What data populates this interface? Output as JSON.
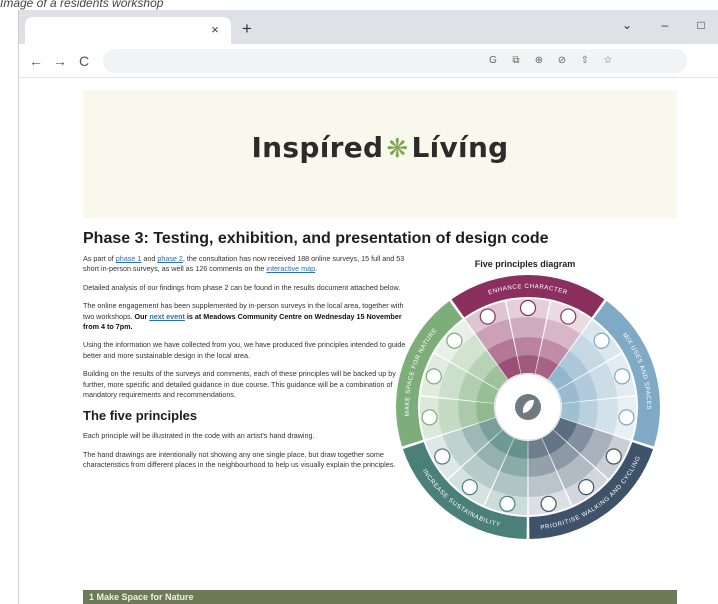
{
  "caption": "Image of a residents workshop",
  "browser": {
    "tab_close": "×",
    "new_tab": "+",
    "controls": {
      "menu": "⌄",
      "minimize": "–",
      "maximize": "□"
    },
    "nav": {
      "back": "←",
      "forward": "→",
      "reload": "C"
    },
    "omnibox_icons": [
      "G",
      "⧉",
      "⊕",
      "⊘",
      "⇧",
      "☆"
    ]
  },
  "hero": {
    "logo_left": "Inspíred",
    "logo_mark": "❋",
    "logo_right": "Lívíng"
  },
  "page": {
    "title": "Phase 3: Testing, exhibition, and presentation of design code",
    "p1": {
      "a": "As part of ",
      "link1": "phase 1",
      "b": " and ",
      "link2": "phase 2",
      "c": ", the consultation has now received 188 online surveys, 15 full and 53 short in-person surveys, as well as 126 comments on the ",
      "link3": "interactive map",
      "d": "."
    },
    "p2": "Detailed analysis of our findings from phase 2 can be found in the results document attached below.",
    "p3": {
      "a": "The online engagement has been supplemented by in-person surveys in the local area, together with two workshops. ",
      "b1": "Our ",
      "link": "next event",
      "b2": " is at Meadows Community Centre on Wednesday 15 November from 4 to 7pm."
    },
    "p4": "Using the information we have collected from you, we have produced five principles intended to guide better and more sustainable design in the local area.",
    "p5": "Building on the results of the surveys and comments, each of these principles will be backed up by further, more specific and detailed guidance in due course. This guidance will be a combination of mandatory requirements and recommendations.",
    "subtitle": "The five principles",
    "p6": "Each principle will be illustrated in the code with an artist's hand drawing.",
    "p7": "The hand drawings are intentionally not showing any one single place, but draw together some characteristics from different places in the neighbourhood to help us visually explain the principles."
  },
  "diagram": {
    "title": "Five principles diagram",
    "segments": [
      {
        "label": "ENHANCE CHARACTER",
        "color": "#8a2f5e"
      },
      {
        "label": "MIX USES AND SPACES",
        "color": "#7fa9c4"
      },
      {
        "label": "PRIORITISE WALKING AND CYCLING",
        "color": "#3e5369"
      },
      {
        "label": "INCREASE SUSTAINABILITY",
        "color": "#4b7f7a"
      },
      {
        "label": "MAKE SPACE FOR NATURE",
        "color": "#7dae7a"
      }
    ]
  },
  "banner": {
    "text": "1  Make Space for Nature"
  }
}
